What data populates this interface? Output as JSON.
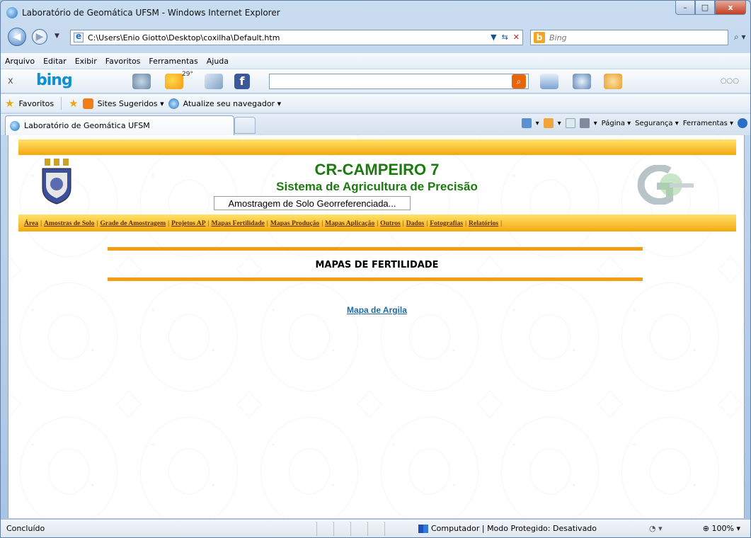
{
  "window": {
    "title": "Laboratório de Geomática UFSM - Windows Internet Explorer",
    "minimize_label": "–",
    "maximize_label": "□",
    "close_label": "x"
  },
  "address": {
    "url": "C:\\Users\\Enio Giotto\\Desktop\\coxilha\\Default.htm",
    "search_placeholder": "Bing"
  },
  "menu": [
    "Arquivo",
    "Editar",
    "Exibir",
    "Favoritos",
    "Ferramentas",
    "Ajuda"
  ],
  "bing_toolbar": {
    "logo": "bing",
    "weather": "29°"
  },
  "favorites_bar": {
    "favorites_label": "Favoritos",
    "suggested_label": "Sites Sugeridos ▾",
    "update_label": "Atualize seu navegador ▾"
  },
  "tab": {
    "title": "Laboratório de Geomática UFSM"
  },
  "command_bar": {
    "page_label": "Página ▾",
    "security_label": "Segurança ▾",
    "tools_label": "Ferramentas ▾"
  },
  "page": {
    "heading": "CR-CAMPEIRO 7",
    "subheading": "Sistema de Agricultura de Precisão",
    "subtitle_box": "Amostragem de Solo Georreferenciada...",
    "nav": [
      "Área",
      "Amostras de Solo",
      "Grade de Amostragem",
      "Projetos AP",
      "Mapas Fertilidade",
      "Mapas Produção",
      "Mapas Aplicação",
      "Outros",
      "Dados",
      "Fotografias",
      "Relatórios"
    ],
    "section_title": "MAPAS DE FERTILIDADE",
    "link": "Mapa de Argila"
  },
  "status": {
    "left": "Concluído",
    "zone": "Computador | Modo Protegido: Desativado",
    "zoom": "100%"
  },
  "colors": {
    "heading_green": "#1d7a10",
    "band_orange": "#f5a70f",
    "link_blue": "#1f6ba0"
  }
}
